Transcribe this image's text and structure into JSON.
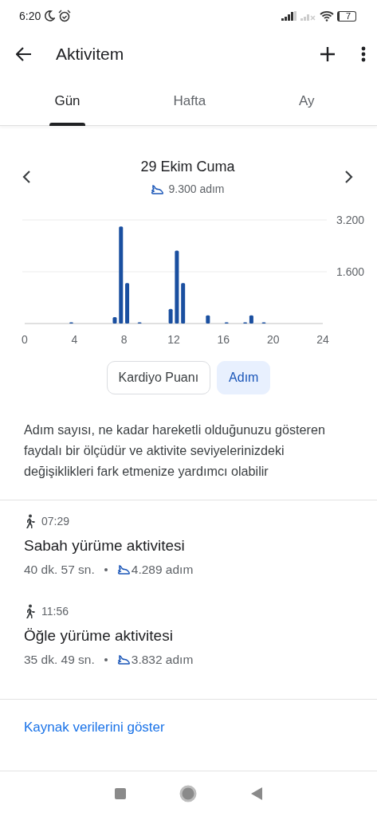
{
  "status_bar": {
    "time": "6:20",
    "battery": "7"
  },
  "app_bar": {
    "title": "Aktivitem"
  },
  "tabs": [
    {
      "label": "Gün",
      "selected": true
    },
    {
      "label": "Hafta",
      "selected": false
    },
    {
      "label": "Ay",
      "selected": false
    }
  ],
  "day": {
    "date": "29 Ekim Cuma",
    "steps": "9.300 adım"
  },
  "chart_data": {
    "type": "bar",
    "x": [
      3.75,
      7.25,
      7.75,
      8.25,
      9.25,
      11.75,
      12.25,
      12.75,
      14.75,
      16.25,
      17.75,
      18.25,
      19.25
    ],
    "values": [
      0,
      200,
      3000,
      1250,
      0,
      450,
      2250,
      1250,
      250,
      0,
      0,
      250,
      0
    ],
    "xlim": [
      0,
      24
    ],
    "ylim": [
      0,
      3200
    ],
    "xticks": [
      0,
      4,
      8,
      12,
      16,
      20,
      24
    ],
    "yticks": [
      {
        "value": 1600,
        "label": "1.600"
      },
      {
        "value": 3200,
        "label": "3.200"
      }
    ]
  },
  "metric_toggle": [
    {
      "label": "Kardiyo Puanı",
      "selected": false
    },
    {
      "label": "Adım",
      "selected": true
    }
  ],
  "description": "Adım sayısı, ne kadar hareketli olduğunuzu gösteren faydalı bir ölçüdür ve aktivite seviyelerinizdeki değişiklikleri fark etmenize yardımcı olabilir",
  "activities": [
    {
      "time": "07:29",
      "title": "Sabah yürüme aktivitesi",
      "duration": "40 dk. 57 sn.",
      "steps": "4.289 adım"
    },
    {
      "time": "11:56",
      "title": "Öğle yürüme aktivitesi",
      "duration": "35 dk. 49 sn.",
      "steps": "3.832 adım"
    }
  ],
  "source_link": "Kaynak verilerini göster"
}
